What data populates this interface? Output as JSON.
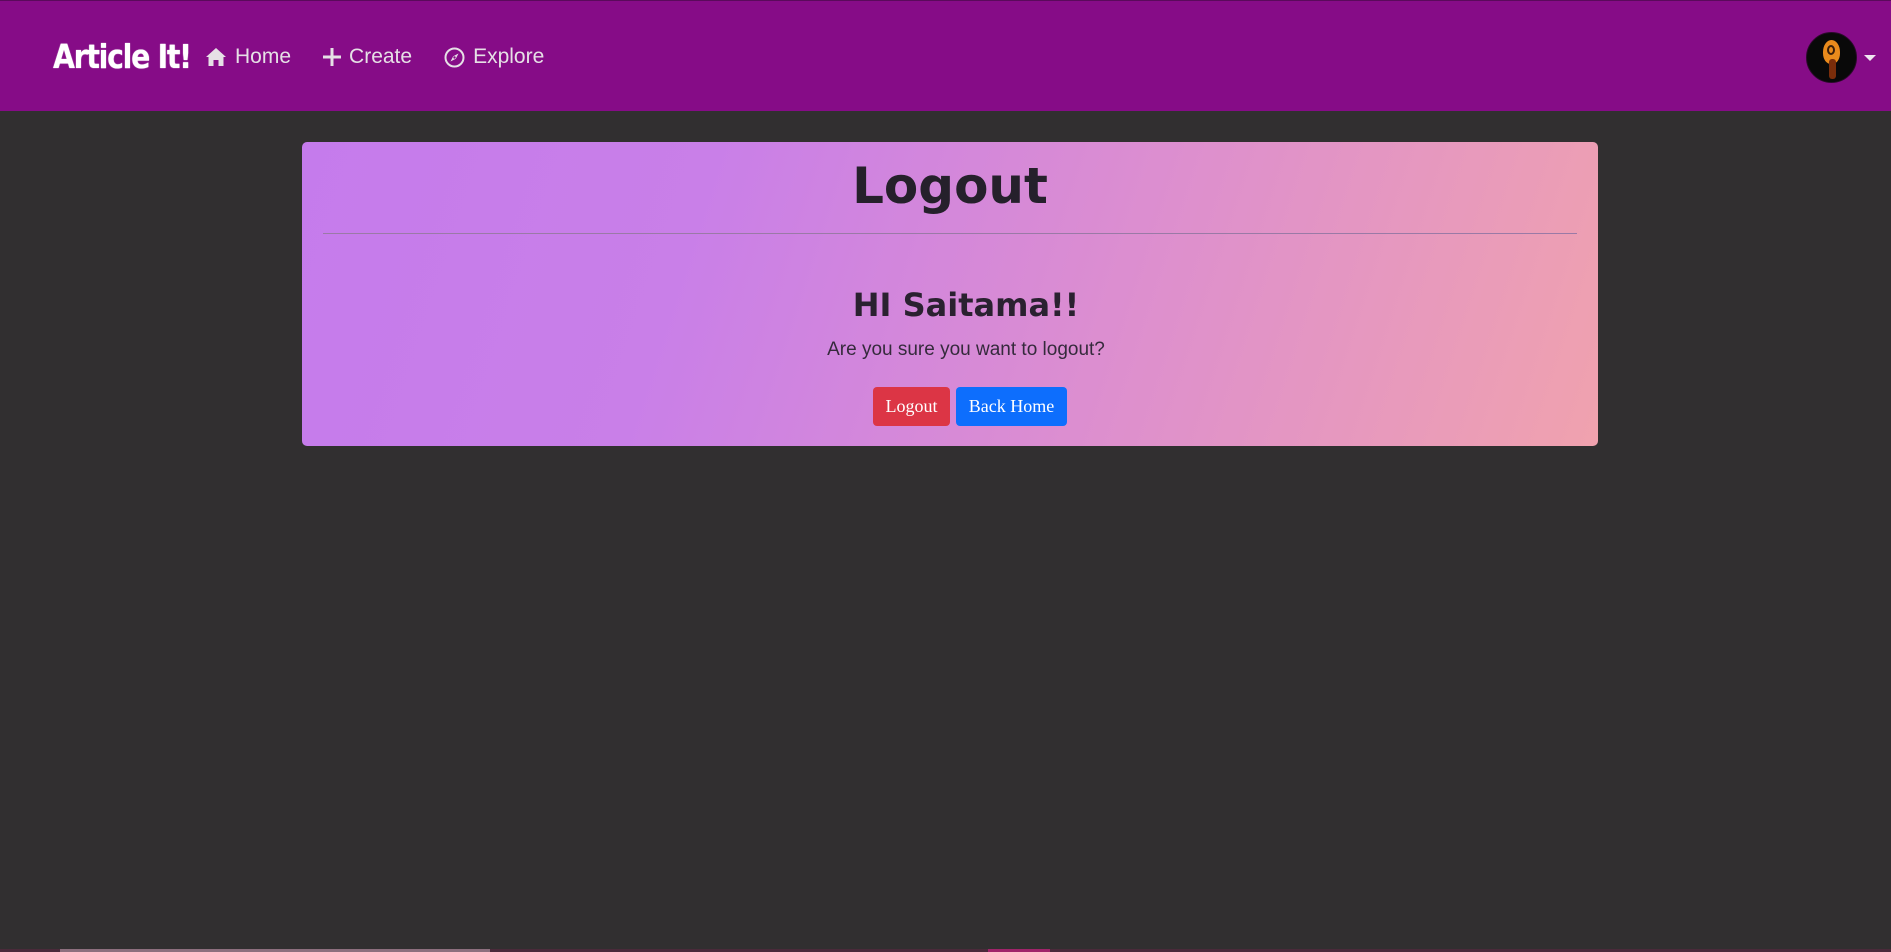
{
  "navbar": {
    "brand": "Article It!",
    "links": [
      {
        "label": "Home",
        "icon": "home-icon"
      },
      {
        "label": "Create",
        "icon": "plus-icon"
      },
      {
        "label": "Explore",
        "icon": "compass-icon"
      }
    ],
    "background_color": "#860c87"
  },
  "card": {
    "title": "Logout",
    "greeting": "HI Saitama!!",
    "question": "Are you sure you want to logout?",
    "buttons": {
      "logout_label": "Logout",
      "home_label": "Back Home"
    }
  },
  "colors": {
    "page_background": "#312f30",
    "danger": "#dc3545",
    "primary": "#0d6efd",
    "gradient_start": "#c57bec",
    "gradient_end": "#f0a2ae"
  }
}
